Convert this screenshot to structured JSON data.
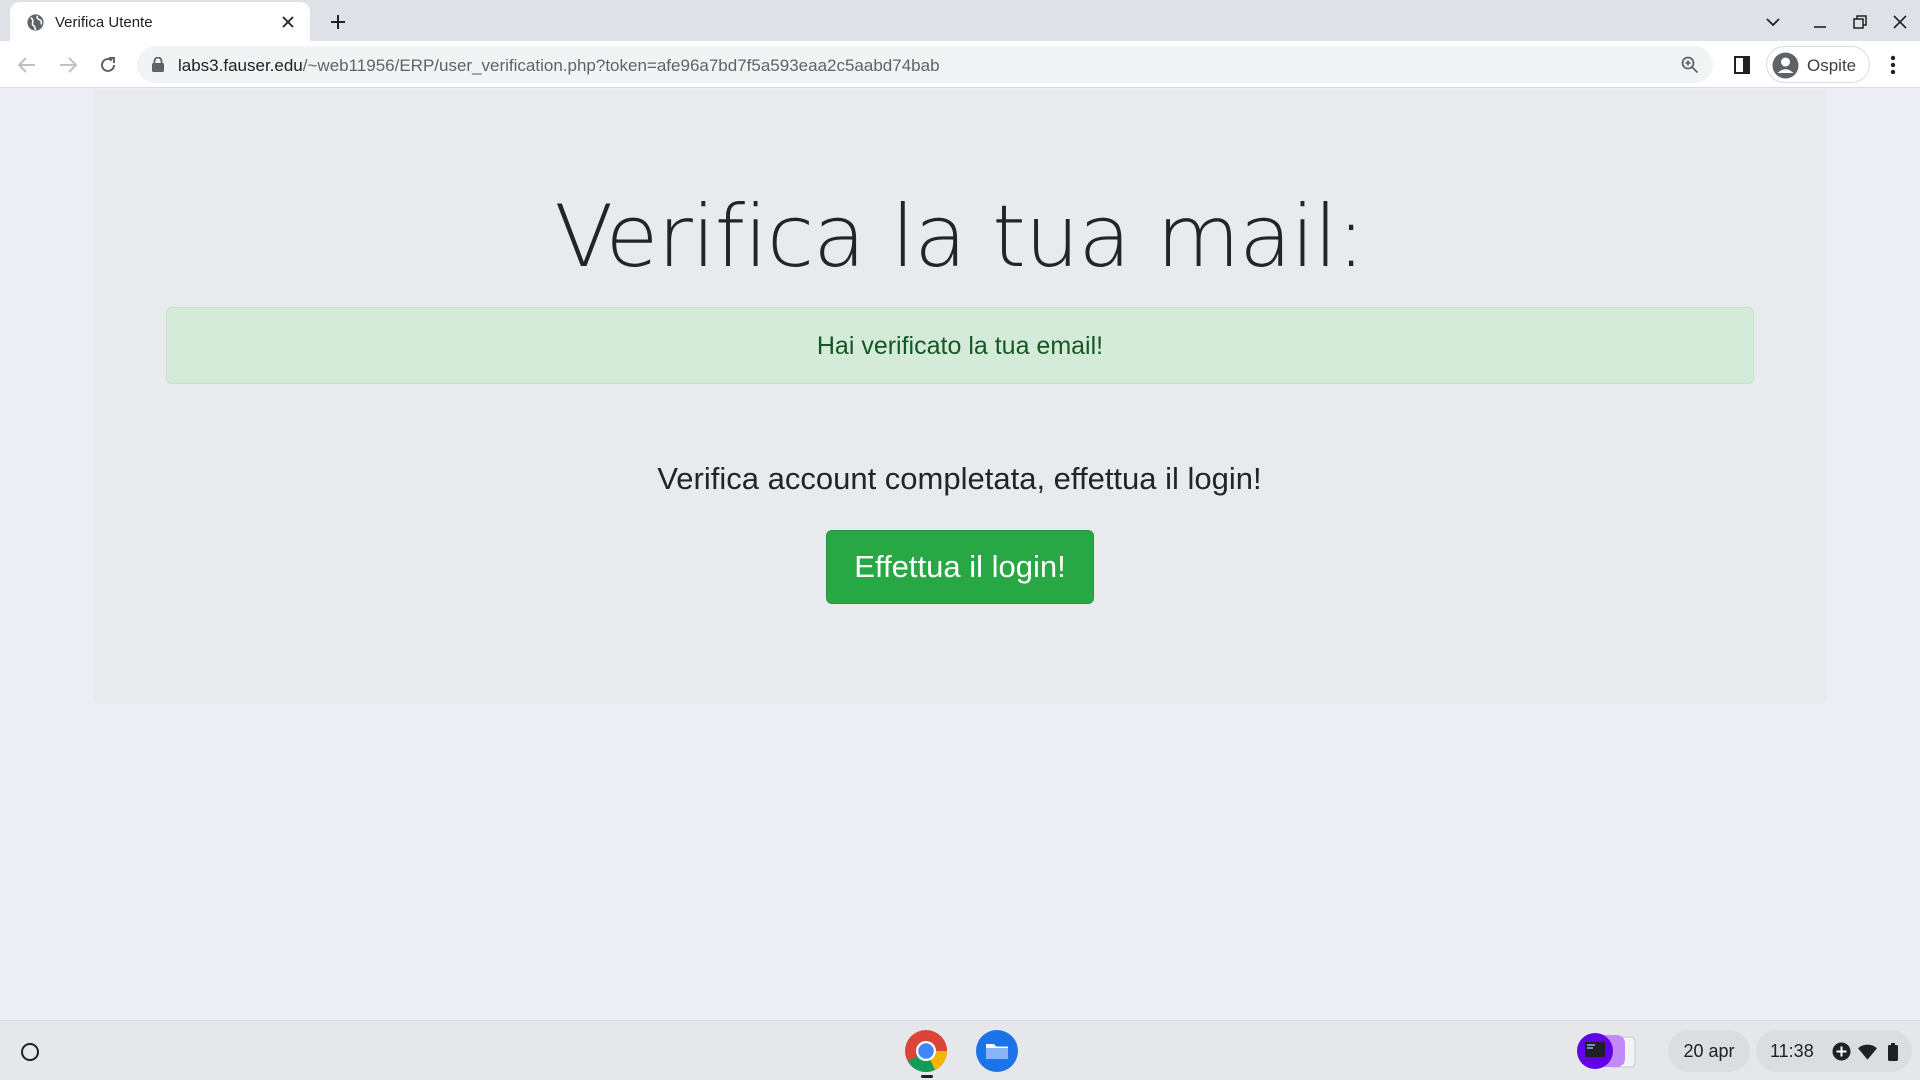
{
  "browser": {
    "tab": {
      "title": "Verifica Utente",
      "favicon": "globe-icon"
    },
    "url": {
      "host": "labs3.fauser.edu",
      "path": "/~web11956/ERP/user_verification.php?token=afe96a7bd7f5a593eaa2c5aabd74bab"
    },
    "profile": {
      "name": "Ospite"
    }
  },
  "page": {
    "headline": "Verifica la tua mail:",
    "alert": {
      "message": "Hai verificato la tua email!",
      "color": "#155724",
      "background": "#d4ebd9"
    },
    "lead": "Verifica account completata, effettua il login!",
    "login_button": {
      "label": "Effettua il login!",
      "color": "#28a745"
    }
  },
  "shelf": {
    "apps": [
      "chrome-icon",
      "files-icon"
    ],
    "date": "20 apr",
    "time": "11:38"
  }
}
